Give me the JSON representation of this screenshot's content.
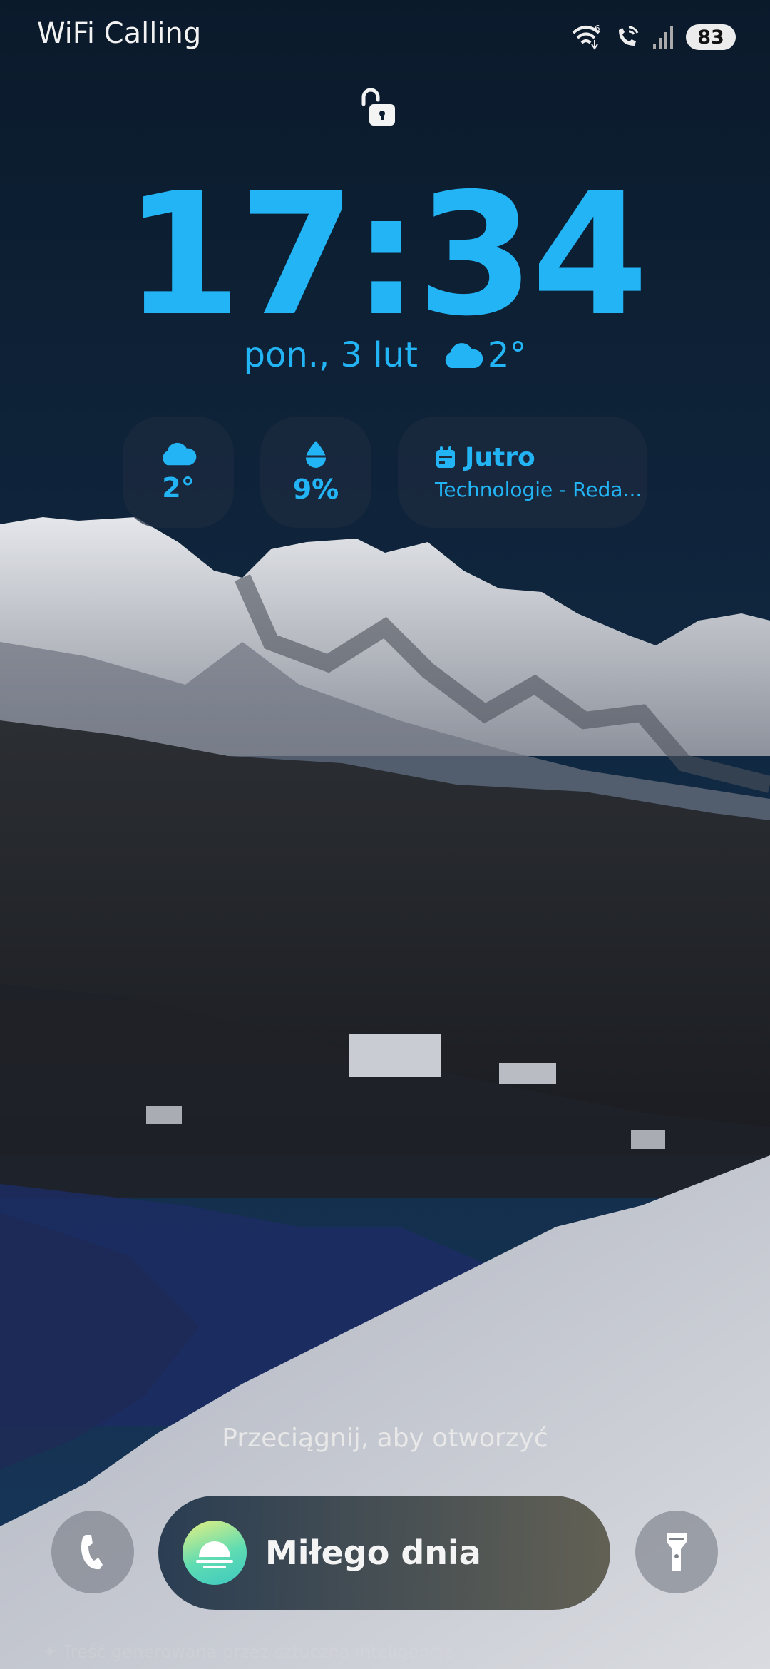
{
  "status_bar": {
    "carrier": "WiFi Calling",
    "battery": "83",
    "icons": [
      "wifi-6-icon",
      "wifi-calling-icon",
      "signal-icon"
    ]
  },
  "lock": {
    "icon": "unlock-icon"
  },
  "clock": {
    "time": "17:34"
  },
  "date": {
    "text": "pon., 3 lut",
    "weather_temp": "2°",
    "weather_icon": "cloud-icon"
  },
  "widgets": {
    "weather": {
      "icon": "cloud-icon",
      "value": "2°"
    },
    "precipitation": {
      "icon": "droplet-icon",
      "value": "9%"
    },
    "calendar": {
      "icon": "calendar-icon",
      "title": "Jutro",
      "subtitle": "Technologie - Reda..."
    }
  },
  "swipe_hint": "Przeciągnij, aby otworzyć",
  "shortcuts": {
    "left": "phone-icon",
    "right": "flashlight-icon"
  },
  "greeting": {
    "icon": "sunrise-icon",
    "text": "Miłego dnia"
  },
  "footer": "✦ Treść generowana przez sztuczną inteligencję",
  "colors": {
    "accent": "#22b4f4",
    "sky_top": "#0c1d30"
  }
}
